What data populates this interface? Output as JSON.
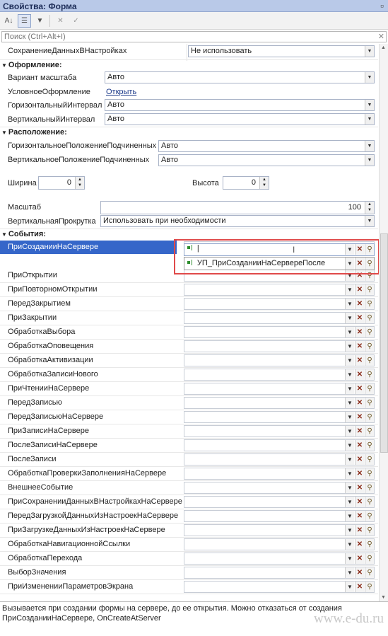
{
  "window": {
    "title": "Свойства: Форма"
  },
  "search": {
    "placeholder": "Поиск (Ctrl+Alt+I)"
  },
  "rows_top": {
    "save_label": "СохранениеДанныхВНастройках",
    "save_value": "Не использовать"
  },
  "groups": {
    "design": "Оформление:",
    "layout": "Расположение:",
    "events": "События:"
  },
  "design": {
    "scale_variant_label": "Вариант масштаба",
    "scale_variant_value": "Авто",
    "cond_label": "УсловноеОформление",
    "cond_link": "Открыть",
    "hinterval_label": "ГоризонтальныйИнтервал",
    "hinterval_value": "Авто",
    "vinterval_label": "ВертикальныйИнтервал",
    "vinterval_value": "Авто"
  },
  "layout": {
    "hpos_label": "ГоризонтальноеПоложениеПодчиненных",
    "hpos_value": "Авто",
    "vpos_label": "ВертикальноеПоложениеПодчиненных",
    "vpos_value": "Авто",
    "width_label": "Ширина",
    "width_value": "0",
    "height_label": "Высота",
    "height_value": "0",
    "scale_label": "Масштаб",
    "scale_value": "100",
    "vscroll_label": "ВертикальнаяПрокрутка",
    "vscroll_value": "Использовать при необходимости"
  },
  "events": {
    "selected_label": "ПриСозданииНаСервере",
    "popup_option": "УП_ПриСозданииНаСервереПосле",
    "items": [
      "ПриОткрытии",
      "ПриПовторномОткрытии",
      "ПередЗакрытием",
      "ПриЗакрытии",
      "ОбработкаВыбора",
      "ОбработкаОповещения",
      "ОбработкаАктивизации",
      "ОбработкаЗаписиНового",
      "ПриЧтенииНаСервере",
      "ПередЗаписью",
      "ПередЗаписьюНаСервере",
      "ПриЗаписиНаСервере",
      "ПослеЗаписиНаСервере",
      "ПослеЗаписи",
      "ОбработкаПроверкиЗаполненияНаСервере",
      "ВнешнееСобытие",
      "ПриСохраненииДанныхВНастройкахНаСервере",
      "ПередЗагрузкойДанныхИзНастроекНаСервере",
      "ПриЗагрузкеДанныхИзНастроекНаСервере",
      "ОбработкаНавигационнойСсылки",
      "ОбработкаПерехода",
      "ВыборЗначения",
      "ПриИзмененииПараметровЭкрана"
    ]
  },
  "description": {
    "line1": "Вызывается при создании формы на сервере, до ее открытия. Можно отказаться от создания",
    "line2": "ПриСозданииНаСервере, OnCreateAtServer"
  },
  "watermark": "www.e-du.ru",
  "colors": {
    "selection": "#3566c9",
    "highlight_frame": "#e04a4a",
    "title_bar": "#b9c9e8"
  }
}
